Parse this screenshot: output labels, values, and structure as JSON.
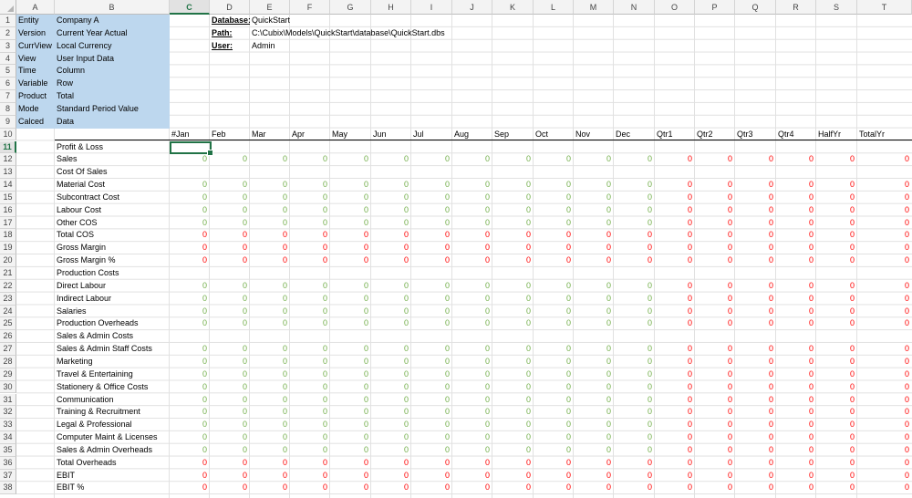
{
  "columns": [
    "A",
    "B",
    "C",
    "D",
    "E",
    "F",
    "G",
    "H",
    "I",
    "J",
    "K",
    "L",
    "M",
    "N",
    "O",
    "P",
    "Q",
    "R",
    "S",
    "T"
  ],
  "active_column": "C",
  "active_row": 11,
  "params": [
    {
      "row": 1,
      "key": "Entity",
      "value": "Company A"
    },
    {
      "row": 2,
      "key": "Version",
      "value": "Current Year Actual"
    },
    {
      "row": 3,
      "key": "CurrView",
      "value": "Local Currency"
    },
    {
      "row": 4,
      "key": "View",
      "value": "User Input Data"
    },
    {
      "row": 5,
      "key": "Time",
      "value": "Column"
    },
    {
      "row": 6,
      "key": "Variable",
      "value": "Row"
    },
    {
      "row": 7,
      "key": "Product",
      "value": "Total"
    },
    {
      "row": 8,
      "key": "Mode",
      "value": "Standard Period Value"
    },
    {
      "row": 9,
      "key": "Calced",
      "value": "Data"
    }
  ],
  "info": [
    {
      "label": "Database:",
      "value": "QuickStart"
    },
    {
      "label": "Path:",
      "value": "C:\\Cubix\\Models\\QuickStart\\database\\QuickStart.dbs"
    },
    {
      "label": "User:",
      "value": "Admin"
    }
  ],
  "period_headers": [
    "#Jan",
    "Feb",
    "Mar",
    "Apr",
    "May",
    "Jun",
    "Jul",
    "Aug",
    "Sep",
    "Oct",
    "Nov",
    "Dec",
    "Qtr1",
    "Qtr2",
    "Qtr3",
    "Qtr4",
    "HalfYr",
    "TotalYr"
  ],
  "rows": [
    {
      "row": 11,
      "label": "Profit & Loss",
      "kind": "blank"
    },
    {
      "row": 12,
      "label": "Sales",
      "kind": "input"
    },
    {
      "row": 13,
      "label": "Cost Of Sales",
      "kind": "blank"
    },
    {
      "row": 14,
      "label": "Material Cost",
      "kind": "input"
    },
    {
      "row": 15,
      "label": "Subcontract Cost",
      "kind": "input"
    },
    {
      "row": 16,
      "label": "Labour Cost",
      "kind": "input"
    },
    {
      "row": 17,
      "label": "Other COS",
      "kind": "input"
    },
    {
      "row": 18,
      "label": "Total COS",
      "kind": "calc"
    },
    {
      "row": 19,
      "label": "Gross Margin",
      "kind": "calc"
    },
    {
      "row": 20,
      "label": "Gross Margin %",
      "kind": "calc"
    },
    {
      "row": 21,
      "label": "Production Costs",
      "kind": "blank"
    },
    {
      "row": 22,
      "label": "Direct Labour",
      "kind": "input"
    },
    {
      "row": 23,
      "label": "Indirect Labour",
      "kind": "input"
    },
    {
      "row": 24,
      "label": "Salaries",
      "kind": "input"
    },
    {
      "row": 25,
      "label": "Production Overheads",
      "kind": "input"
    },
    {
      "row": 26,
      "label": "Sales & Admin Costs",
      "kind": "blank"
    },
    {
      "row": 27,
      "label": "Sales & Admin Staff Costs",
      "kind": "input"
    },
    {
      "row": 28,
      "label": "Marketing",
      "kind": "input"
    },
    {
      "row": 29,
      "label": "Travel & Entertaining",
      "kind": "input"
    },
    {
      "row": 30,
      "label": "Stationery & Office Costs",
      "kind": "input"
    },
    {
      "row": 31,
      "label": "Communication",
      "kind": "input"
    },
    {
      "row": 32,
      "label": "Training & Recruitment",
      "kind": "input"
    },
    {
      "row": 33,
      "label": "Legal & Professional",
      "kind": "input"
    },
    {
      "row": 34,
      "label": "Computer Maint & Licenses",
      "kind": "input"
    },
    {
      "row": 35,
      "label": "Sales & Admin Overheads",
      "kind": "input"
    },
    {
      "row": 36,
      "label": "Total Overheads",
      "kind": "calc"
    },
    {
      "row": 37,
      "label": "EBIT",
      "kind": "calc"
    },
    {
      "row": 38,
      "label": "EBIT %",
      "kind": "calc"
    }
  ],
  "cell_value": "0",
  "colors": {
    "input_value": "#70ad47",
    "calc_value": "#ff0000",
    "param_fill": "#bdd7ee",
    "selection": "#217346"
  }
}
